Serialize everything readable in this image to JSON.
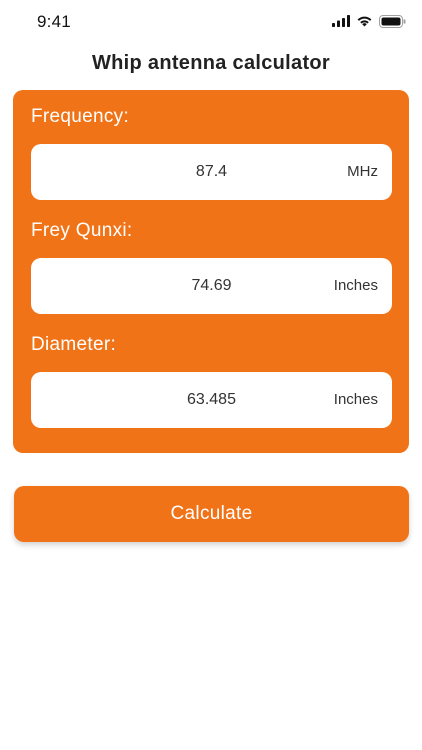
{
  "status_bar": {
    "time": "9:41",
    "icons": [
      "cellular-signal-icon",
      "wifi-icon",
      "battery-icon"
    ]
  },
  "header": {
    "title": "Whip antenna calculator"
  },
  "form": {
    "fields": [
      {
        "label": "Frequency:",
        "value": "87.4",
        "unit": "MHz"
      },
      {
        "label": "Frey Qunxi:",
        "value": "74.69",
        "unit": "Inches"
      },
      {
        "label": "Diameter:",
        "value": "63.485",
        "unit": "Inches"
      }
    ]
  },
  "actions": {
    "calculate_label": "Calculate"
  },
  "colors": {
    "accent": "#f07318",
    "field_background": "#ffffff",
    "text": "#222222"
  }
}
